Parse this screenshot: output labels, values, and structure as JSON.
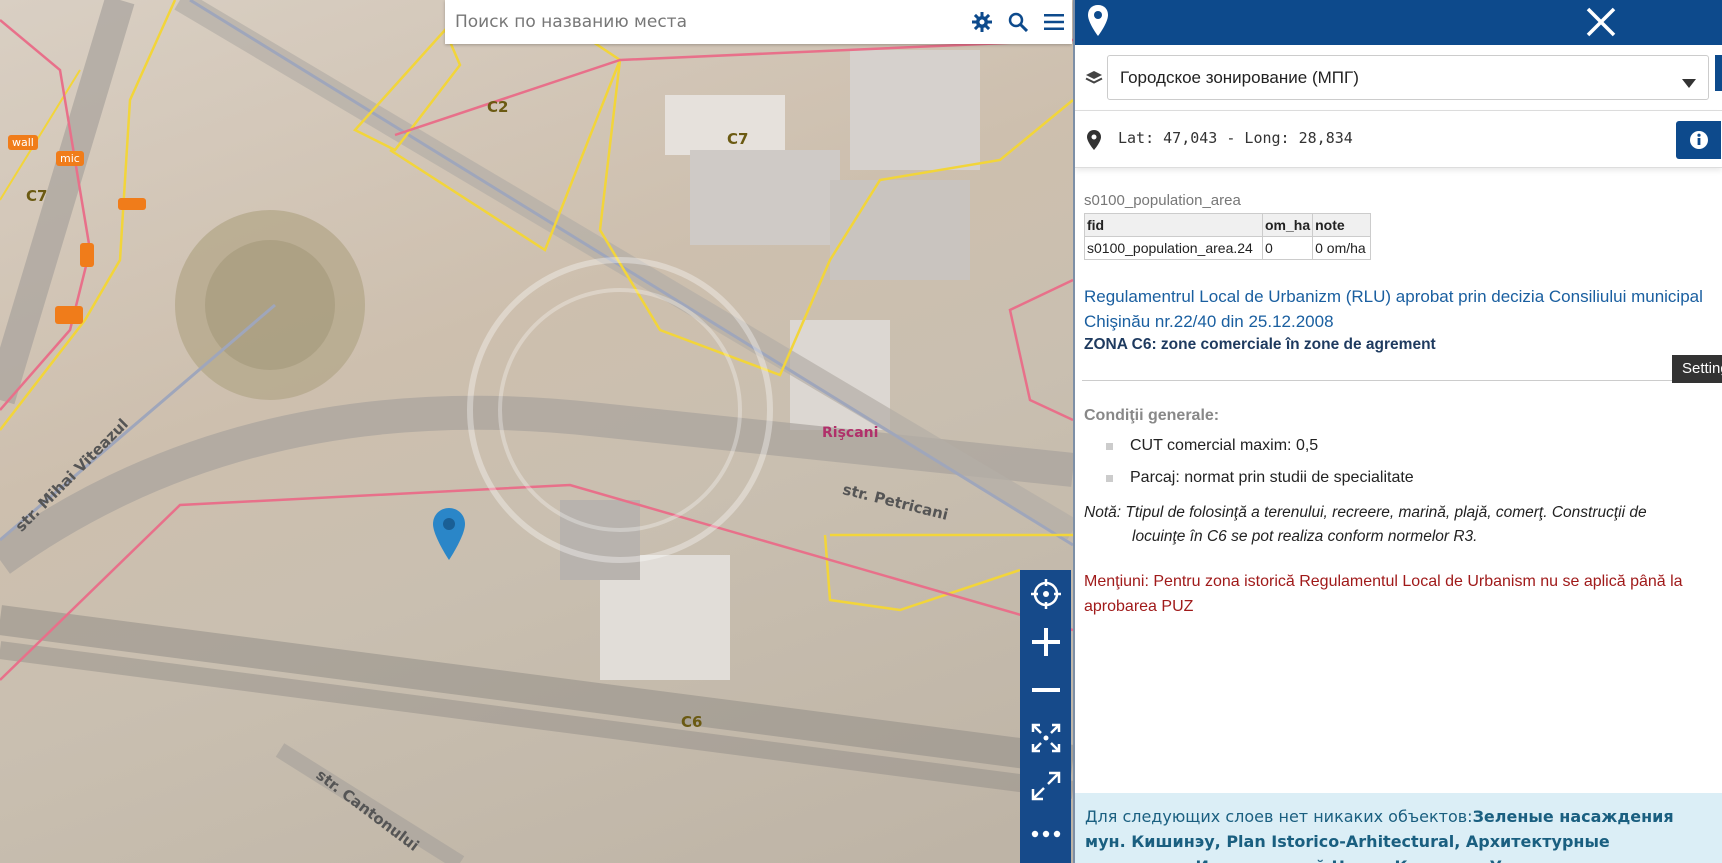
{
  "search": {
    "placeholder": "Поиск по названию места"
  },
  "map": {
    "zone_labels": [
      "C2",
      "C7",
      "C7",
      "C6"
    ],
    "district_label": "Rişcani",
    "road_labels": [
      "str. Mihai Viteazul",
      "str. Petricani",
      "str. Cantonului"
    ],
    "poi_labels": [
      "wall",
      "mic"
    ],
    "colors": {
      "zone_border": "#f2d53a",
      "district_border": "#e8708a",
      "marker": "#2a86c8"
    }
  },
  "panel": {
    "layer_select": "Городское зонирование (МПГ)",
    "coords": "Lat: 47,043 - Long: 28,834",
    "layer_title": "s0100_population_area",
    "table": {
      "headers": [
        "fid",
        "om_ha",
        "note"
      ],
      "row": [
        "s0100_population_area.24",
        "0",
        "0 om/ha"
      ]
    },
    "rlu_text": "Regulamentrul Local de Urbanizm (RLU) aprobat prin decizia Consiliului municipal Chişinău nr.22/40 din 25.12.2008",
    "zona": "ZONA C6: zone comerciale în zone de agrement",
    "conditions_title": "Condiţii generale:",
    "conditions": [
      "CUT comercial maxim: 0,5",
      "Parcaj: normat prin studii de specialitate"
    ],
    "nota_label": "Notă:",
    "nota_text": "Ttipul de folosinţă a terenului, recreere, marină, plajă, comerţ. Construcţii de locuinţe în C6 se pot realiza conform normelor R3.",
    "mentiuni": "Menţiuni: Pentru zona istorică Regulamentul Local de Urbanism nu se aplică până la aprobarea PUZ",
    "settings_tab": "Settings",
    "bottom_prefix": "Для следующих слоев нет никаких объектов:",
    "bottom_layers": "Зеленые насаждения мун. Кишинэу, Plan Istorico-Arhitectural, Архитектурные памятники, Исторический Центр Кишинэу, Уличная реклама, Градостроительная зона"
  }
}
